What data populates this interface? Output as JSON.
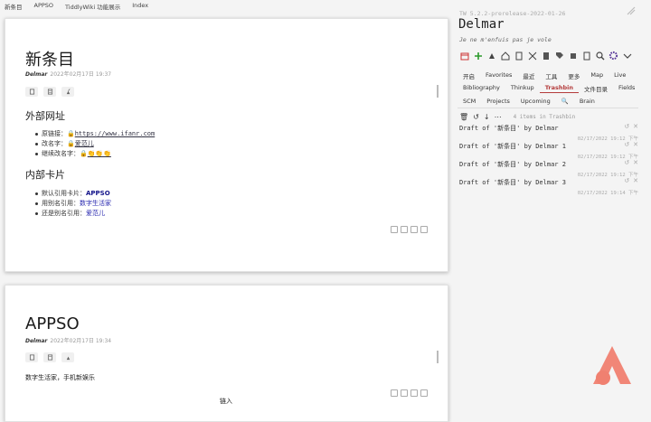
{
  "topbar": {
    "items": [
      "新条目",
      "APPSO",
      "TiddlyWiki 功能展示",
      "Index"
    ]
  },
  "tiddler1": {
    "title": "新条目",
    "author": "Delmar",
    "date": "2022年02月17日 19:37",
    "section1": "外部网址",
    "links": [
      {
        "prefix": "原链接：",
        "text": "https://www.ifanr.com"
      },
      {
        "prefix": "改名字：",
        "text": "爱范儿"
      },
      {
        "prefix": "继续改名字：",
        "text": "👏👏👏"
      }
    ],
    "section2": "内部卡片",
    "refs": [
      {
        "prefix": "默认引用卡片：",
        "text": "APPSO"
      },
      {
        "prefix": "用别名引用：",
        "text": "数字生活家"
      },
      {
        "prefix": "还是别名引用：",
        "text": "爱范儿"
      }
    ]
  },
  "tiddler2": {
    "title": "APPSO",
    "author": "Delmar",
    "date": "2022年02月17日 19:34",
    "body": "数字生活家，手机新娱乐"
  },
  "bottom_text": "链入",
  "sidebar": {
    "version": "TW 5.2.2-prerelease-2022-01-26",
    "site_title": "Delmar",
    "site_subtitle": "Je ne m'enfuis pas je vole",
    "tabs_row1": [
      "开启",
      "Favorites",
      "最近",
      "工具",
      "更多",
      "Map",
      "Live"
    ],
    "tabs_row2": [
      "Bibliography",
      "Thinkup",
      "Trashbin",
      "文件目录",
      "Fields"
    ],
    "tabs_row3": [
      "SCM",
      "Projects",
      "Upcoming",
      "🔍",
      "Brain"
    ],
    "active_tab": "Trashbin",
    "trash_count": "4 items in Trashbin",
    "drafts": [
      {
        "title": "Draft of '新条目' by Delmar",
        "date": "02/17/2022 19:12 下午"
      },
      {
        "title": "Draft of '新条目' by Delmar 1",
        "date": "02/17/2022 19:12 下午"
      },
      {
        "title": "Draft of '新条目' by Delmar 2",
        "date": "02/17/2022 19:12 下午"
      },
      {
        "title": "Draft of '新条目' by Delmar 3",
        "date": "02/17/2022 19:14 下午"
      }
    ]
  },
  "colors": {
    "accent": "#b43c3c",
    "link": "#2a2ab0",
    "logo": "#f08070"
  }
}
